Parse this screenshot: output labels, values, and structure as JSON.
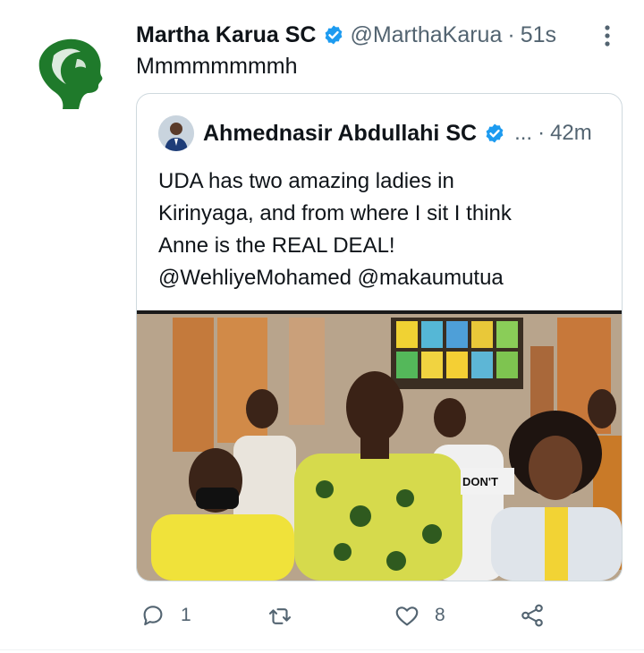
{
  "tweet": {
    "author_name": "Martha Karua SC",
    "author_handle": "@MarthaKarua",
    "separator": "·",
    "time": "51s",
    "text": "Mmmmmmmmh"
  },
  "quoted_tweet": {
    "author_name": "Ahmednasir Abdullahi SC",
    "author_handle_truncated": "...",
    "separator": "·",
    "time": "42m",
    "text_lines": [
      "UDA has two amazing ladies in",
      "Kirinyaga, and from where I sit I think",
      "Anne is the REAL DEAL!",
      "@WehliyeMohamed @makaumutua"
    ],
    "photo_overlay_text": "DON'T"
  },
  "actions": {
    "reply_count": "1",
    "like_count": "8"
  },
  "colors": {
    "text_primary": "#0f1419",
    "text_secondary": "#536471",
    "verified_blue": "#1d9bf0",
    "border": "#cfd9de",
    "logo_green": "#1f7a2b"
  },
  "icons": [
    "verified-badge-icon",
    "more-options-icon",
    "reply-icon",
    "retweet-icon",
    "like-icon",
    "share-icon"
  ]
}
